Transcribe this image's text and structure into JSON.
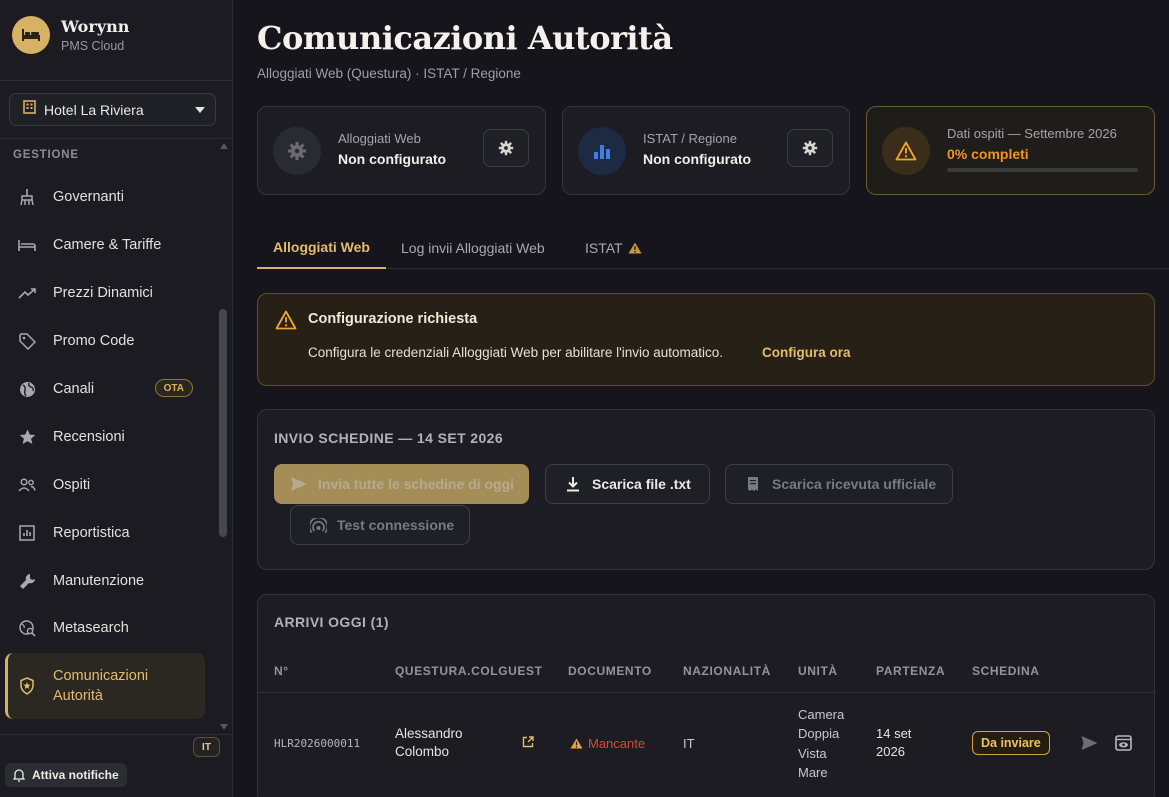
{
  "brand": {
    "name": "Worynn",
    "subtitle": "PMS Cloud",
    "icon": "bed-icon"
  },
  "hotel_selector": {
    "value": "Hotel La Riviera",
    "icon": "building-icon"
  },
  "sidebar": {
    "section": "GESTIONE",
    "items": [
      {
        "label": "Governanti",
        "icon": "broom-icon"
      },
      {
        "label": "Camere & Tariffe",
        "icon": "bed-icon"
      },
      {
        "label": "Prezzi Dinamici",
        "icon": "trending-up-icon"
      },
      {
        "label": "Promo Code",
        "icon": "tag-icon"
      },
      {
        "label": "Canali",
        "icon": "globe-icon",
        "badge": "OTA"
      },
      {
        "label": "Recensioni",
        "icon": "star-icon"
      },
      {
        "label": "Ospiti",
        "icon": "users-icon"
      },
      {
        "label": "Reportistica",
        "icon": "chart-icon"
      },
      {
        "label": "Manutenzione",
        "icon": "wrench-icon"
      },
      {
        "label": "Metasearch",
        "icon": "globe-search-icon"
      },
      {
        "label_line1": "Comunicazioni",
        "label_line2": "Autorità",
        "icon": "shield-star-icon",
        "active": true
      }
    ],
    "language": "IT",
    "notify_label": "Attiva notifiche"
  },
  "header": {
    "title": "Comunicazioni Autorità",
    "subtitle": "Alloggiati Web (Questura) · ISTAT / Regione"
  },
  "status_cards": [
    {
      "title": "Alloggiati Web",
      "value": "Non configurato",
      "icon": "gear-icon"
    },
    {
      "title": "ISTAT / Regione",
      "value": "Non configurato",
      "icon": "bar-chart-icon"
    },
    {
      "title": "Dati ospiti — Settembre 2026",
      "value": "0% completi",
      "icon": "warning-icon",
      "progress_percent": 0
    }
  ],
  "tabs": [
    {
      "label": "Alloggiati Web",
      "active": true
    },
    {
      "label": "Log invii Alloggiati Web",
      "active": false
    },
    {
      "label": "ISTAT",
      "active": false,
      "icon": "warning-icon"
    }
  ],
  "alert": {
    "title": "Configurazione richiesta",
    "text": "Configura le credenziali Alloggiati Web per abilitare l'invio automatico.",
    "link": "Configura ora"
  },
  "send_panel": {
    "title": "INVIO SCHEDINE — 14 SET 2026",
    "buttons": {
      "send_all": "Invia tutte le schedine di oggi",
      "download_txt": "Scarica file .txt",
      "download_receipt": "Scarica ricevuta ufficiale",
      "test_connection": "Test connessione"
    }
  },
  "arrivals": {
    "title": "ARRIVI OGGI (1)",
    "columns": [
      "N°",
      "QUESTURA.COLGUEST",
      "DOCUMENTO",
      "NAZIONALITÀ",
      "UNITÀ",
      "PARTENZA",
      "SCHEDINA"
    ],
    "rows": [
      {
        "number": "HLR2026000011",
        "guest_line1": "Alessandro",
        "guest_line2": "Colombo",
        "document": "Mancante",
        "nationality": "IT",
        "unit_lines": [
          "Camera",
          "Doppia",
          "Vista",
          "Mare"
        ],
        "departure_line1": "14 set",
        "departure_line2": "2026",
        "status": "Da inviare"
      }
    ]
  },
  "colors": {
    "accent_gold": "#d8b264",
    "warning_orange": "#f09328",
    "danger_red": "#e0453a",
    "istat_blue": "#3d7fe0"
  }
}
